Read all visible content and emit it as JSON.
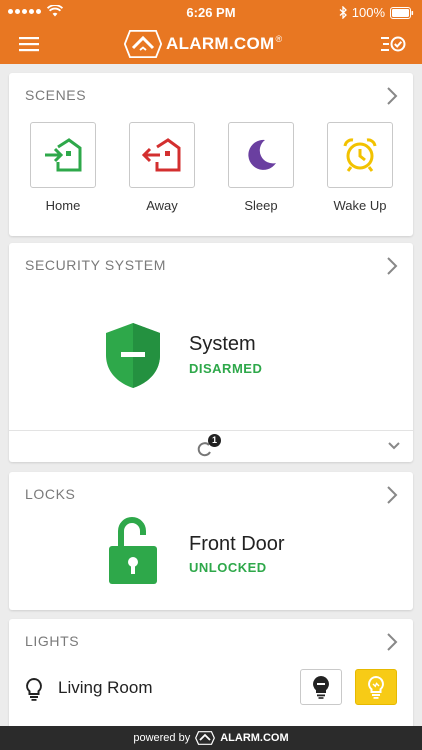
{
  "status_bar": {
    "time": "6:26 PM",
    "battery": "100%"
  },
  "header": {
    "brand": "ALARM.COM",
    "brand_mark": "®"
  },
  "scenes": {
    "title": "SCENES",
    "items": [
      {
        "label": "Home",
        "icon": "home-arrive-icon",
        "color": "#2ea84a"
      },
      {
        "label": "Away",
        "icon": "home-leave-icon",
        "color": "#d32f2f"
      },
      {
        "label": "Sleep",
        "icon": "moon-icon",
        "color": "#6a3fa0"
      },
      {
        "label": "Wake Up",
        "icon": "alarm-clock-icon",
        "color": "#f2c200"
      }
    ]
  },
  "security": {
    "title": "SECURITY SYSTEM",
    "name": "System",
    "status": "DISARMED",
    "badge": "1",
    "status_color": "#2ea84a"
  },
  "locks": {
    "title": "LOCKS",
    "name": "Front Door",
    "status": "UNLOCKED",
    "status_color": "#2ea84a"
  },
  "lights": {
    "title": "LIGHTS",
    "name": "Living Room",
    "on_color": "#f7cb16"
  },
  "footer": {
    "powered_by": "powered by",
    "brand": "ALARM.COM"
  },
  "colors": {
    "brand": "#e87722",
    "card_bg": "#ffffff",
    "page_bg": "#ececec"
  }
}
